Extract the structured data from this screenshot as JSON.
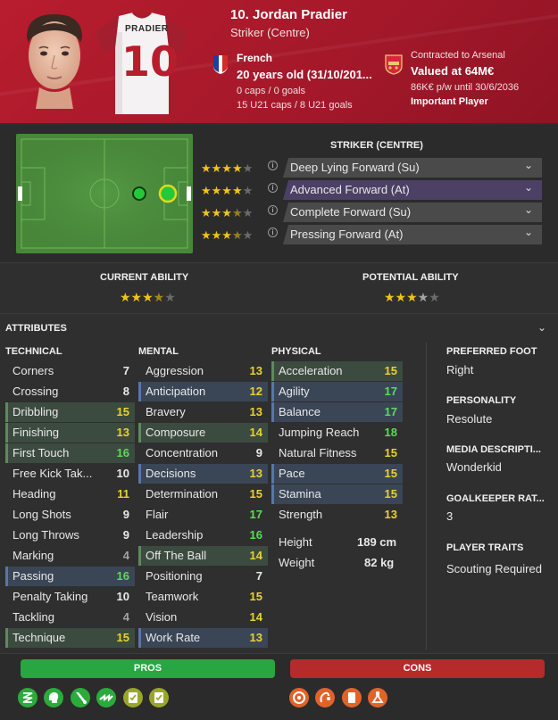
{
  "header": {
    "name": "10. Jordan Pradier",
    "position": "Striker (Centre)",
    "shirt_name": "PRADIER",
    "shirt_number": "10",
    "nationality": "French",
    "age": "20 years old (31/10/201...",
    "caps": "0 caps / 0 goals",
    "u21": "15 U21 caps / 8 U21 goals",
    "contract": "Contracted to Arsenal",
    "value": "Valued at 64M€",
    "wage": "86K€ p/w until 30/6/2036",
    "status": "Important Player",
    "colors": {
      "club_red": "#b81d2e"
    }
  },
  "roles": {
    "title": "STRIKER (CENTRE)",
    "items": [
      {
        "label": "Deep Lying Forward (Su)",
        "stars": 4,
        "selected": false
      },
      {
        "label": "Advanced Forward (At)",
        "stars": 4,
        "selected": true
      },
      {
        "label": "Complete Forward (Su)",
        "stars": 3.5,
        "selected": false
      },
      {
        "label": "Pressing Forward (At)",
        "stars": 3.5,
        "selected": false
      }
    ]
  },
  "ability": {
    "current_label": "CURRENT ABILITY",
    "current_stars": 3.5,
    "potential_label": "POTENTIAL ABILITY",
    "potential_stars": 3.5
  },
  "attributes": {
    "title": "ATTRIBUTES",
    "technical_title": "TECHNICAL",
    "mental_title": "MENTAL",
    "physical_title": "PHYSICAL",
    "technical": [
      {
        "name": "Corners",
        "value": "7",
        "color": "white",
        "hl": ""
      },
      {
        "name": "Crossing",
        "value": "8",
        "color": "white",
        "hl": ""
      },
      {
        "name": "Dribbling",
        "value": "15",
        "color": "yellow",
        "hl": "g"
      },
      {
        "name": "Finishing",
        "value": "13",
        "color": "yellow",
        "hl": "g"
      },
      {
        "name": "First Touch",
        "value": "16",
        "color": "green",
        "hl": "g"
      },
      {
        "name": "Free Kick Tak...",
        "value": "10",
        "color": "white",
        "hl": ""
      },
      {
        "name": "Heading",
        "value": "11",
        "color": "yellow",
        "hl": ""
      },
      {
        "name": "Long Shots",
        "value": "9",
        "color": "white",
        "hl": ""
      },
      {
        "name": "Long Throws",
        "value": "9",
        "color": "white",
        "hl": ""
      },
      {
        "name": "Marking",
        "value": "4",
        "color": "grey",
        "hl": ""
      },
      {
        "name": "Passing",
        "value": "16",
        "color": "green",
        "hl": "b"
      },
      {
        "name": "Penalty Taking",
        "value": "10",
        "color": "white",
        "hl": ""
      },
      {
        "name": "Tackling",
        "value": "4",
        "color": "grey",
        "hl": ""
      },
      {
        "name": "Technique",
        "value": "15",
        "color": "yellow",
        "hl": "g"
      }
    ],
    "mental": [
      {
        "name": "Aggression",
        "value": "13",
        "color": "yellow",
        "hl": ""
      },
      {
        "name": "Anticipation",
        "value": "12",
        "color": "yellow",
        "hl": "b"
      },
      {
        "name": "Bravery",
        "value": "13",
        "color": "yellow",
        "hl": ""
      },
      {
        "name": "Composure",
        "value": "14",
        "color": "yellow",
        "hl": "g"
      },
      {
        "name": "Concentration",
        "value": "9",
        "color": "white",
        "hl": ""
      },
      {
        "name": "Decisions",
        "value": "13",
        "color": "yellow",
        "hl": "b"
      },
      {
        "name": "Determination",
        "value": "15",
        "color": "yellow",
        "hl": ""
      },
      {
        "name": "Flair",
        "value": "17",
        "color": "green",
        "hl": ""
      },
      {
        "name": "Leadership",
        "value": "16",
        "color": "green",
        "hl": ""
      },
      {
        "name": "Off The Ball",
        "value": "14",
        "color": "yellow",
        "hl": "g"
      },
      {
        "name": "Positioning",
        "value": "7",
        "color": "white",
        "hl": ""
      },
      {
        "name": "Teamwork",
        "value": "15",
        "color": "yellow",
        "hl": ""
      },
      {
        "name": "Vision",
        "value": "14",
        "color": "yellow",
        "hl": ""
      },
      {
        "name": "Work Rate",
        "value": "13",
        "color": "yellow",
        "hl": "b"
      }
    ],
    "physical": [
      {
        "name": "Acceleration",
        "value": "15",
        "color": "yellow",
        "hl": "g"
      },
      {
        "name": "Agility",
        "value": "17",
        "color": "green",
        "hl": "b"
      },
      {
        "name": "Balance",
        "value": "17",
        "color": "green",
        "hl": "b"
      },
      {
        "name": "Jumping Reach",
        "value": "18",
        "color": "green",
        "hl": ""
      },
      {
        "name": "Natural Fitness",
        "value": "15",
        "color": "yellow",
        "hl": ""
      },
      {
        "name": "Pace",
        "value": "15",
        "color": "yellow",
        "hl": "b"
      },
      {
        "name": "Stamina",
        "value": "15",
        "color": "yellow",
        "hl": "b"
      },
      {
        "name": "Strength",
        "value": "13",
        "color": "yellow",
        "hl": ""
      }
    ],
    "height_label": "Height",
    "height_value": "189 cm",
    "weight_label": "Weight",
    "weight_value": "82 kg"
  },
  "side": {
    "foot_title": "PREFERRED FOOT",
    "foot_value": "Right",
    "personality_title": "PERSONALITY",
    "personality_value": "Resolute",
    "media_title": "MEDIA DESCRIPTI...",
    "media_value": "Wonderkid",
    "gk_title": "GOALKEEPER RAT...",
    "gk_value": "3",
    "traits_title": "PLAYER TRAITS",
    "traits_value": "Scouting Required"
  },
  "pros_cons": {
    "pros_label": "PROS",
    "cons_label": "CONS",
    "pros_icons": [
      "flair-icon",
      "mental-icon",
      "technique-icon",
      "speed-icon",
      "attack-scouting-icon",
      "check-scouting-icon"
    ],
    "cons_icons": [
      "target-icon",
      "aerial-icon",
      "card-icon",
      "lab-icon"
    ]
  }
}
